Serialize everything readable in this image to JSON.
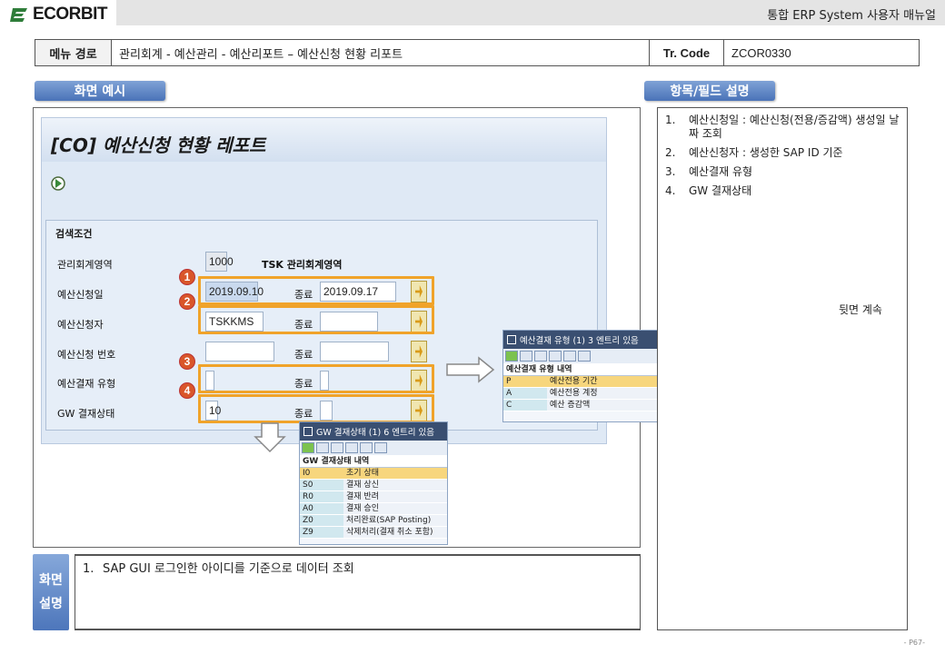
{
  "header": {
    "logo_text": "ECORBIT",
    "manual_title": "통합 ERP System 사용자 매뉴얼"
  },
  "menu_path": {
    "label": "메뉴 경로",
    "path": "관리회계 - 예산관리 - 예산리포트 – 예산신청 현황 리포트",
    "tr_label": "Tr. Code",
    "tr_code": "ZCOR0330"
  },
  "sections": {
    "screen_example": "화면 예시",
    "field_description": "항목/필드 설명"
  },
  "sap": {
    "title": "[CO] 예산신청 현황 레포트",
    "conditions_title": "검색조건",
    "rows": [
      {
        "label": "관리회계영역",
        "value": "1000",
        "text": "TSK 관리회계영역"
      },
      {
        "label": "예산신청일",
        "from": "2019.09.10",
        "to_label": "종료",
        "to": "2019.09.17"
      },
      {
        "label": "예산신청자",
        "from": "TSKKMS",
        "to_label": "종료",
        "to": ""
      },
      {
        "label": "예산신청 번호",
        "from": "",
        "to_label": "종료",
        "to": ""
      },
      {
        "label": "예산결재 유형",
        "from": "",
        "to_label": "종료",
        "to": ""
      },
      {
        "label": "GW 결재상태",
        "from": "10",
        "to_label": "종료",
        "to": ""
      }
    ],
    "markers": [
      "1",
      "2",
      "3",
      "4"
    ]
  },
  "popup_budget": {
    "title": "예산결재 유형 (1)   3 엔트리 있음",
    "column": "예산결재 유형 내역",
    "rows": [
      {
        "code": "P",
        "desc": "예산전용 기간"
      },
      {
        "code": "A",
        "desc": "예산전용 계정"
      },
      {
        "code": "C",
        "desc": "예산 증감액"
      }
    ]
  },
  "popup_gw": {
    "title": "GW 결재상태 (1)   6 엔트리 있음",
    "column": "GW 결재상태 내역",
    "rows": [
      {
        "code": "I0",
        "desc": "초기 상태"
      },
      {
        "code": "S0",
        "desc": "결재 상신"
      },
      {
        "code": "R0",
        "desc": "결재 반려"
      },
      {
        "code": "A0",
        "desc": "결재 승인"
      },
      {
        "code": "Z0",
        "desc": "처리완료(SAP Posting)"
      },
      {
        "code": "Z9",
        "desc": "삭제처리(결재 취소 포함)"
      }
    ]
  },
  "field_desc": {
    "items": [
      {
        "n": "1.",
        "text": "예산신청일  :  예산신청(전용/증감액) 생성일 날짜 조회"
      },
      {
        "n": "2.",
        "text": "예산신청자 : 생성한 SAP ID 기준"
      },
      {
        "n": "3.",
        "text": "예산결재 유형"
      },
      {
        "n": "4.",
        "text": "GW 결재상태"
      }
    ],
    "continue": "뒷면 계속"
  },
  "screen_desc": {
    "label_line1": "화면",
    "label_line2": "설명",
    "items": [
      {
        "n": "1.",
        "text": "SAP GUI 로그인한 아이디를 기준으로 데이터 조회"
      }
    ]
  },
  "page_no": "- P67-"
}
